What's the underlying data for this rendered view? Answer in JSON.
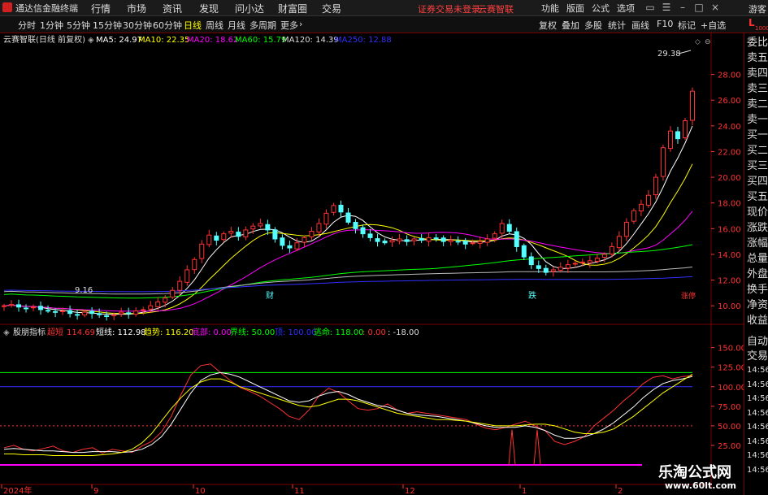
{
  "app": {
    "title": "通达信金融终端",
    "notice": "证券交易未登录",
    "brand": "云赛智联",
    "user": "游客"
  },
  "menu": [
    "行情",
    "市场",
    "资讯",
    "发现",
    "问小达",
    "财富圈",
    "交易"
  ],
  "menu_right": [
    "功能",
    "版面",
    "公式",
    "选项"
  ],
  "periods": [
    "分时",
    "1分钟",
    "5分钟",
    "15分钟",
    "30分钟",
    "60分钟",
    "日线",
    "周线",
    "月线",
    "多周期",
    "更多"
  ],
  "active_period": "日线",
  "tools": [
    "复权",
    "叠加",
    "多股",
    "统计",
    "画线",
    "F10",
    "标记",
    "+自选"
  ],
  "top_right": {
    "letter": "L",
    "sub": "1000"
  },
  "ma_bar": {
    "stock": "云赛智联(日线 前复权)",
    "ma5": "MA5: 24.97",
    "ma10": "MA10: 22.35",
    "ma20": "MA20: 18.62",
    "ma60": "MA60: 15.79",
    "ma120": "MA120: 14.39",
    "ma250": "MA250: 12.88"
  },
  "indicator_bar": {
    "name": "股朋指标",
    "chaobuy": "超短",
    "chaobuy_val": "114.69",
    "short": "短线: 112.98",
    "trend": "趋势: 116.20",
    "bottom": "底部: 0.00",
    "boundary": "界线: 50.00",
    "top": "顶: 100.00",
    "escape": "逃命: 118.00",
    "v1": ": 0.00",
    "v2": ": -18.00"
  },
  "annotations": {
    "high": "29.38",
    "low": "9.16",
    "fin": "财",
    "drop": "跌",
    "hot": "涨停"
  },
  "price_axis": [
    "28.00",
    "26.00",
    "24.00",
    "22.00",
    "20.00",
    "18.00",
    "16.00",
    "14.00",
    "12.00",
    "10.00"
  ],
  "indicator_axis": [
    "150.00",
    "125.00",
    "100.00",
    "75.00",
    "50.00",
    "25.00"
  ],
  "time_axis": [
    "2024年",
    "9",
    "10",
    "11",
    "12",
    "1",
    "2"
  ],
  "side_labels": [
    "委比",
    "卖五",
    "卖四",
    "卖三",
    "卖二",
    "卖一",
    "买一",
    "买二",
    "买三",
    "买四",
    "买五",
    "现价",
    "涨跌",
    "涨幅",
    "总量",
    "外盘",
    "换手",
    "净资",
    "收益"
  ],
  "side_labels_low": [
    "自动",
    "交易",
    "14:56",
    "14:56",
    "14:56",
    "14:56",
    "14:56",
    "14:56",
    "14:56",
    "14:56"
  ],
  "watermark": {
    "main": "乐淘公式网",
    "url": "www.60lt.com"
  },
  "colors": {
    "up": "#ff3232",
    "down": "#54ffff",
    "ma5": "#ffffff",
    "ma10": "#ffff00",
    "ma20": "#ff00ff",
    "ma60": "#00ff00",
    "ma120": "#bbbbbb",
    "ma250": "#3030ff"
  },
  "chart_data": [
    {
      "type": "candlestick",
      "title": "云赛智联(日线 前复权)",
      "ylim": [
        9,
        30
      ],
      "closes": [
        10.0,
        10.1,
        9.9,
        9.8,
        9.9,
        9.7,
        9.6,
        9.5,
        9.6,
        9.4,
        9.3,
        9.5,
        9.4,
        9.3,
        9.2,
        9.3,
        9.5,
        9.4,
        9.6,
        9.7,
        10.0,
        10.3,
        10.6,
        11.2,
        11.9,
        12.8,
        13.6,
        14.8,
        15.5,
        15.1,
        15.6,
        15.8,
        15.4,
        15.9,
        16.2,
        16.4,
        15.9,
        15.2,
        14.7,
        14.5,
        14.9,
        15.3,
        15.8,
        16.4,
        17.2,
        17.8,
        17.3,
        16.5,
        16.0,
        15.6,
        15.3,
        15.0,
        14.9,
        15.1,
        15.2,
        15.0,
        15.2,
        15.1,
        15.3,
        15.2,
        15.0,
        15.1,
        15.0,
        14.8,
        14.9,
        15.0,
        15.2,
        15.6,
        16.4,
        15.8,
        14.6,
        13.8,
        13.2,
        12.9,
        12.6,
        12.8,
        13.0,
        13.2,
        13.3,
        13.4,
        13.5,
        13.7,
        14.0,
        14.6,
        15.4,
        16.5,
        17.4,
        17.9,
        18.6,
        20.0,
        22.3,
        23.6,
        23.0,
        24.4,
        26.7
      ]
    },
    {
      "type": "line",
      "title": "股朋指标",
      "ylim": [
        0,
        160
      ],
      "series": [
        {
          "name": "超短",
          "values": [
            22,
            25,
            20,
            18,
            21,
            24,
            18,
            16,
            20,
            22,
            15,
            20,
            18,
            16,
            24,
            30,
            42,
            62,
            90,
            115,
            127,
            129,
            118,
            108,
            99,
            94,
            88,
            80,
            72,
            62,
            58,
            70,
            88,
            98,
            93,
            82,
            72,
            70,
            72,
            78,
            70,
            66,
            68,
            66,
            64,
            62,
            60,
            58,
            52,
            47,
            45,
            48,
            52,
            56,
            50,
            44,
            30,
            26,
            30,
            36,
            50,
            60,
            70,
            82,
            92,
            104,
            112,
            114,
            110,
            113,
            114
          ]
        },
        {
          "name": "短线",
          "values": [
            20,
            21,
            20,
            19,
            18,
            18,
            17,
            16,
            16,
            17,
            17,
            17,
            16,
            17,
            20,
            26,
            36,
            52,
            72,
            92,
            108,
            115,
            118,
            116,
            112,
            106,
            100,
            94,
            88,
            82,
            80,
            82,
            88,
            92,
            94,
            90,
            84,
            80,
            76,
            74,
            70,
            66,
            64,
            63,
            62,
            60,
            58,
            56,
            53,
            50,
            48,
            48,
            48,
            50,
            48,
            44,
            38,
            34,
            34,
            36,
            40,
            46,
            54,
            64,
            74,
            86,
            96,
            104,
            108,
            110,
            113
          ]
        },
        {
          "name": "趋势",
          "values": [
            14,
            14,
            13,
            13,
            13,
            12,
            12,
            12,
            12,
            12,
            13,
            14,
            16,
            20,
            28,
            40,
            56,
            72,
            86,
            98,
            106,
            110,
            110,
            106,
            100,
            96,
            92,
            88,
            84,
            80,
            76,
            74,
            76,
            80,
            84,
            84,
            82,
            78,
            74,
            70,
            66,
            64,
            62,
            60,
            58,
            58,
            57,
            56,
            54,
            52,
            50,
            50,
            50,
            51,
            52,
            52,
            50,
            46,
            42,
            40,
            40,
            42,
            46,
            54,
            62,
            72,
            82,
            92,
            100,
            108,
            116
          ]
        }
      ]
    }
  ]
}
